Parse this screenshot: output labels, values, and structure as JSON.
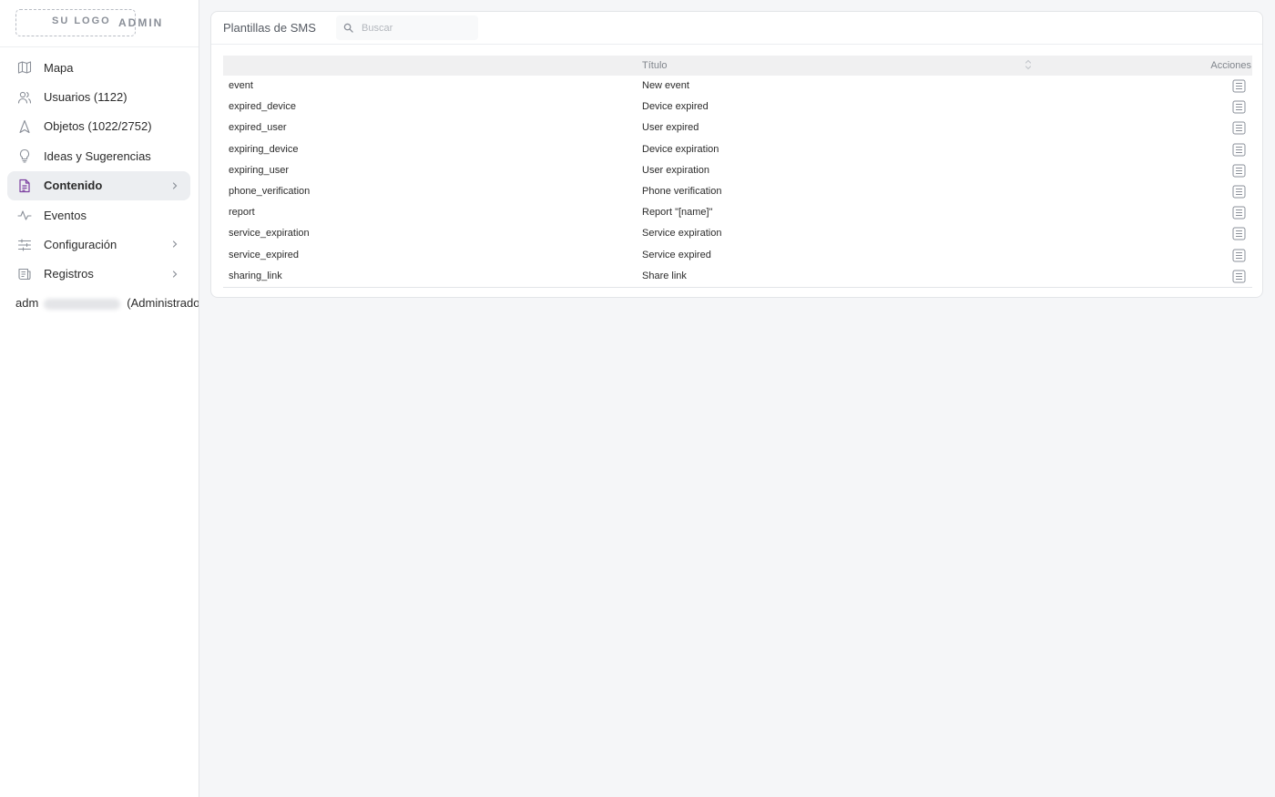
{
  "sidebar": {
    "logo_text": "SU LOGO",
    "admin_text": "ADMIN",
    "items": [
      {
        "label": "Mapa",
        "icon": "map-icon"
      },
      {
        "label": "Usuarios (1122)",
        "icon": "users-icon"
      },
      {
        "label": "Objetos (1022/2752)",
        "icon": "navigation-arrow-icon"
      },
      {
        "label": "Ideas y Sugerencias",
        "icon": "lightbulb-icon"
      },
      {
        "label": "Contenido",
        "icon": "document-icon",
        "active": true,
        "has_submenu": true
      },
      {
        "label": "Eventos",
        "icon": "activity-icon"
      },
      {
        "label": "Configuración",
        "icon": "sliders-icon",
        "has_submenu": true
      },
      {
        "label": "Registros",
        "icon": "log-scroll-icon",
        "has_submenu": true
      }
    ],
    "user": {
      "name": "adm",
      "role": "(Administrador)"
    },
    "accent_color": "#7b3fa0"
  },
  "panel": {
    "title": "Plantillas de SMS",
    "search_placeholder": "Buscar"
  },
  "table": {
    "columns": {
      "title": "Título",
      "actions": "Acciones"
    },
    "rows": [
      {
        "key": "event",
        "title": "New event"
      },
      {
        "key": "expired_device",
        "title": "Device expired"
      },
      {
        "key": "expired_user",
        "title": "User expired"
      },
      {
        "key": "expiring_device",
        "title": "Device expiration"
      },
      {
        "key": "expiring_user",
        "title": "User expiration"
      },
      {
        "key": "phone_verification",
        "title": "Phone verification"
      },
      {
        "key": "report",
        "title": "Report \"[name]\""
      },
      {
        "key": "service_expiration",
        "title": "Service expiration"
      },
      {
        "key": "service_expired",
        "title": "Service expired"
      },
      {
        "key": "sharing_link",
        "title": "Share link"
      }
    ]
  }
}
